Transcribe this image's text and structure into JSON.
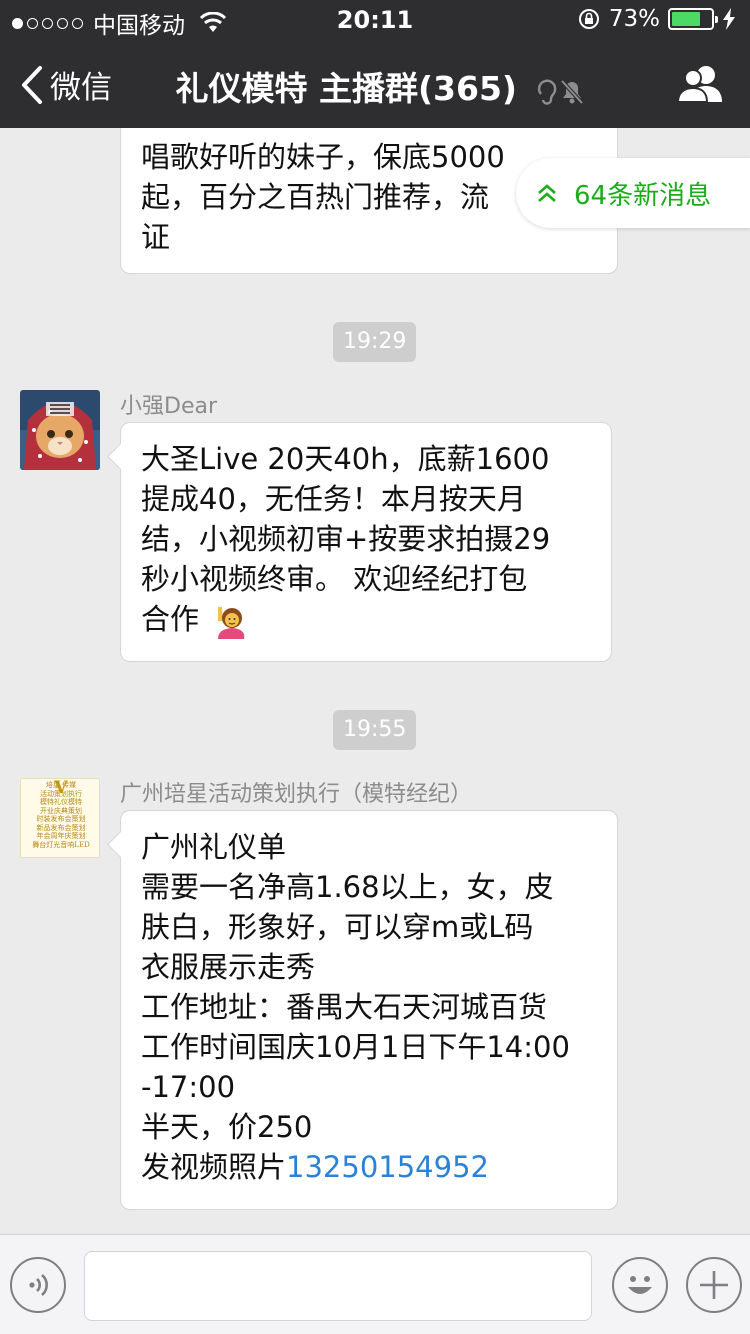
{
  "status_bar": {
    "carrier": "中国移动",
    "time": "20:11",
    "battery_percent": "73%",
    "battery_level": 0.73,
    "signal_bars": 1
  },
  "nav": {
    "back_label": "微信",
    "title": "礼仪模特 主播群(365)"
  },
  "chat": {
    "new_messages_label": "64条新消息",
    "first_bubble": {
      "lines": [
        "唱歌好听的妹子，保底5000",
        "起，百分之百热门推荐，流",
        "证"
      ]
    },
    "time_1": "19:29",
    "message_1": {
      "sender": "小强Dear",
      "lines": [
        "大圣Live 20天40h，底薪1600",
        "提成40，无任务！本月按天月",
        "结，小视频初审+按要求拍摄29",
        "秒小视频终审。 欢迎经纪打包",
        "合作"
      ],
      "emoji": "raising-hand-emoji"
    },
    "time_2": "19:55",
    "message_2": {
      "sender": "广州培星活动策划执行（模特经纪）",
      "lines": [
        "广州礼仪单",
        "需要一名净高1.68以上，女，皮",
        "肤白，形象好，可以穿m或L码",
        "衣服展示走秀",
        "工作地址：番禺大石天河城百货",
        "工作时间国庆10月1日下午14:00",
        "-17:00",
        "半天，价250"
      ],
      "last_line_prefix": "发视频照片",
      "phone": "13250154952"
    },
    "avatar_2": {
      "lines": [
        "培星 传媒",
        "活动策划执行",
        "模特礼仪模特",
        "开业庆典策划",
        "时装发布会策划",
        "新品发布会策划",
        "年会周年庆策划",
        "舞台灯光音响LED"
      ],
      "mark": "V"
    }
  },
  "colors": {
    "nav_bg": "#2e2e30",
    "chat_bg": "#ebebeb",
    "link": "#2b82d9",
    "new_msg_green": "#1aad19",
    "battery_green": "#4cd964"
  }
}
